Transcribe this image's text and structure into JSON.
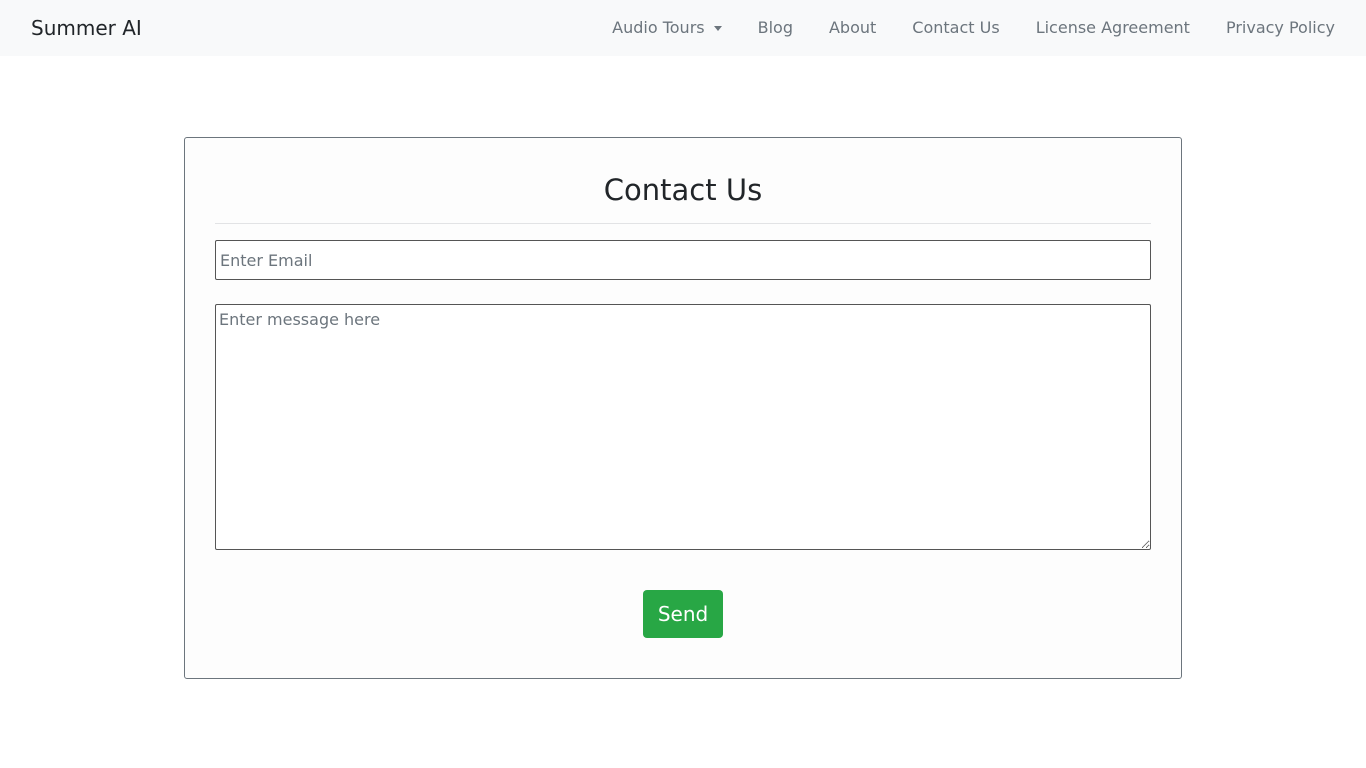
{
  "navbar": {
    "brand": "Summer AI",
    "links": [
      {
        "label": "Audio Tours",
        "dropdown": true
      },
      {
        "label": "Blog"
      },
      {
        "label": "About"
      },
      {
        "label": "Contact Us"
      },
      {
        "label": "License Agreement"
      },
      {
        "label": "Privacy Policy"
      }
    ]
  },
  "contact_form": {
    "title": "Contact Us",
    "email": {
      "value": "",
      "placeholder": "Enter Email"
    },
    "message": {
      "value": "",
      "placeholder": "Enter message here"
    },
    "send_label": "Send"
  },
  "colors": {
    "navbar_bg": "#f8f9fa",
    "nav_link": "#6c757d",
    "send_button": "#28a745"
  },
  "icons": {
    "dropdown": "caret-down-icon"
  }
}
